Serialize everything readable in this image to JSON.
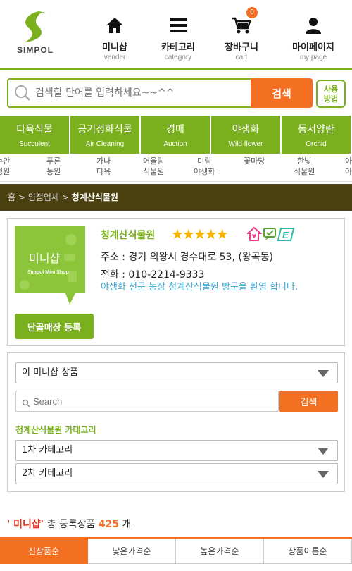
{
  "header": {
    "logo_text": "SIMPOL",
    "nav": [
      {
        "ko": "미니샵",
        "en": "vender",
        "icon": "home-icon"
      },
      {
        "ko": "카테고리",
        "en": "category",
        "icon": "menu-icon"
      },
      {
        "ko": "장바구니",
        "en": "cart",
        "icon": "cart-icon",
        "badge": "0"
      },
      {
        "ko": "마이페이지",
        "en": "my page",
        "icon": "user-icon"
      }
    ]
  },
  "search": {
    "placeholder": "검색할 단어를 입력하세요~~^^",
    "button": "검색",
    "usage_line1": "사용",
    "usage_line2": "방법"
  },
  "categories": [
    {
      "ko": "다육식물",
      "en": "Succulent"
    },
    {
      "ko": "공기정화식물",
      "en": "Air Cleaning"
    },
    {
      "ko": "경매",
      "en": "Auction"
    },
    {
      "ko": "야생화",
      "en": "Wild flower"
    },
    {
      "ko": "동서양란",
      "en": "Orchid"
    }
  ],
  "subcategories": [
    {
      "l1": "수안",
      "l2": "정원"
    },
    {
      "l1": "푸른",
      "l2": "농원"
    },
    {
      "l1": "가나",
      "l2": "다육"
    },
    {
      "l1": "어울림",
      "l2": "식물원"
    },
    {
      "l1": "미림",
      "l2": "야생화"
    },
    {
      "l1": "꽃마당",
      "l2": ""
    },
    {
      "l1": "한빛",
      "l2": "식물원"
    },
    {
      "l1": "아",
      "l2": "아"
    }
  ],
  "breadcrumb": {
    "home": "홈",
    "sep": ">",
    "level1": "입점업체",
    "current": "청계산식물원"
  },
  "shop": {
    "logo_title": "미니샵",
    "logo_sub": "Simpol Mini Shop",
    "name": "청계산식물원",
    "stars": "★★★★★",
    "address": "주소 : 경기 의왕시 경수대로 53, (왕곡동)",
    "phone": "전화 : 010-2214-9333",
    "description": "야생화 전문 농장 청계산식물원 방문을 환영 합니다.",
    "regular_button": "단골매장 등록",
    "badge_e": "E"
  },
  "filter": {
    "product_select": "이 미니샵 상품",
    "search_placeholder": "Search",
    "search_button": "검색",
    "category_heading": "청계산식물원 카테고리",
    "cat1_select": "1차 카테고리",
    "cat2_select": "2차 카테고리"
  },
  "count": {
    "shop_label": "' 미니샵'",
    "text": " 총 등록상품 ",
    "number": "425",
    "unit": "개"
  },
  "sort_tabs": [
    "신상품순",
    "낮은가격순",
    "높은가격순",
    "상품이름순"
  ],
  "colors": {
    "brand_green": "#7aaf1e",
    "accent_orange": "#f36f21",
    "breadcrumb_bg": "#4a3f0e"
  }
}
